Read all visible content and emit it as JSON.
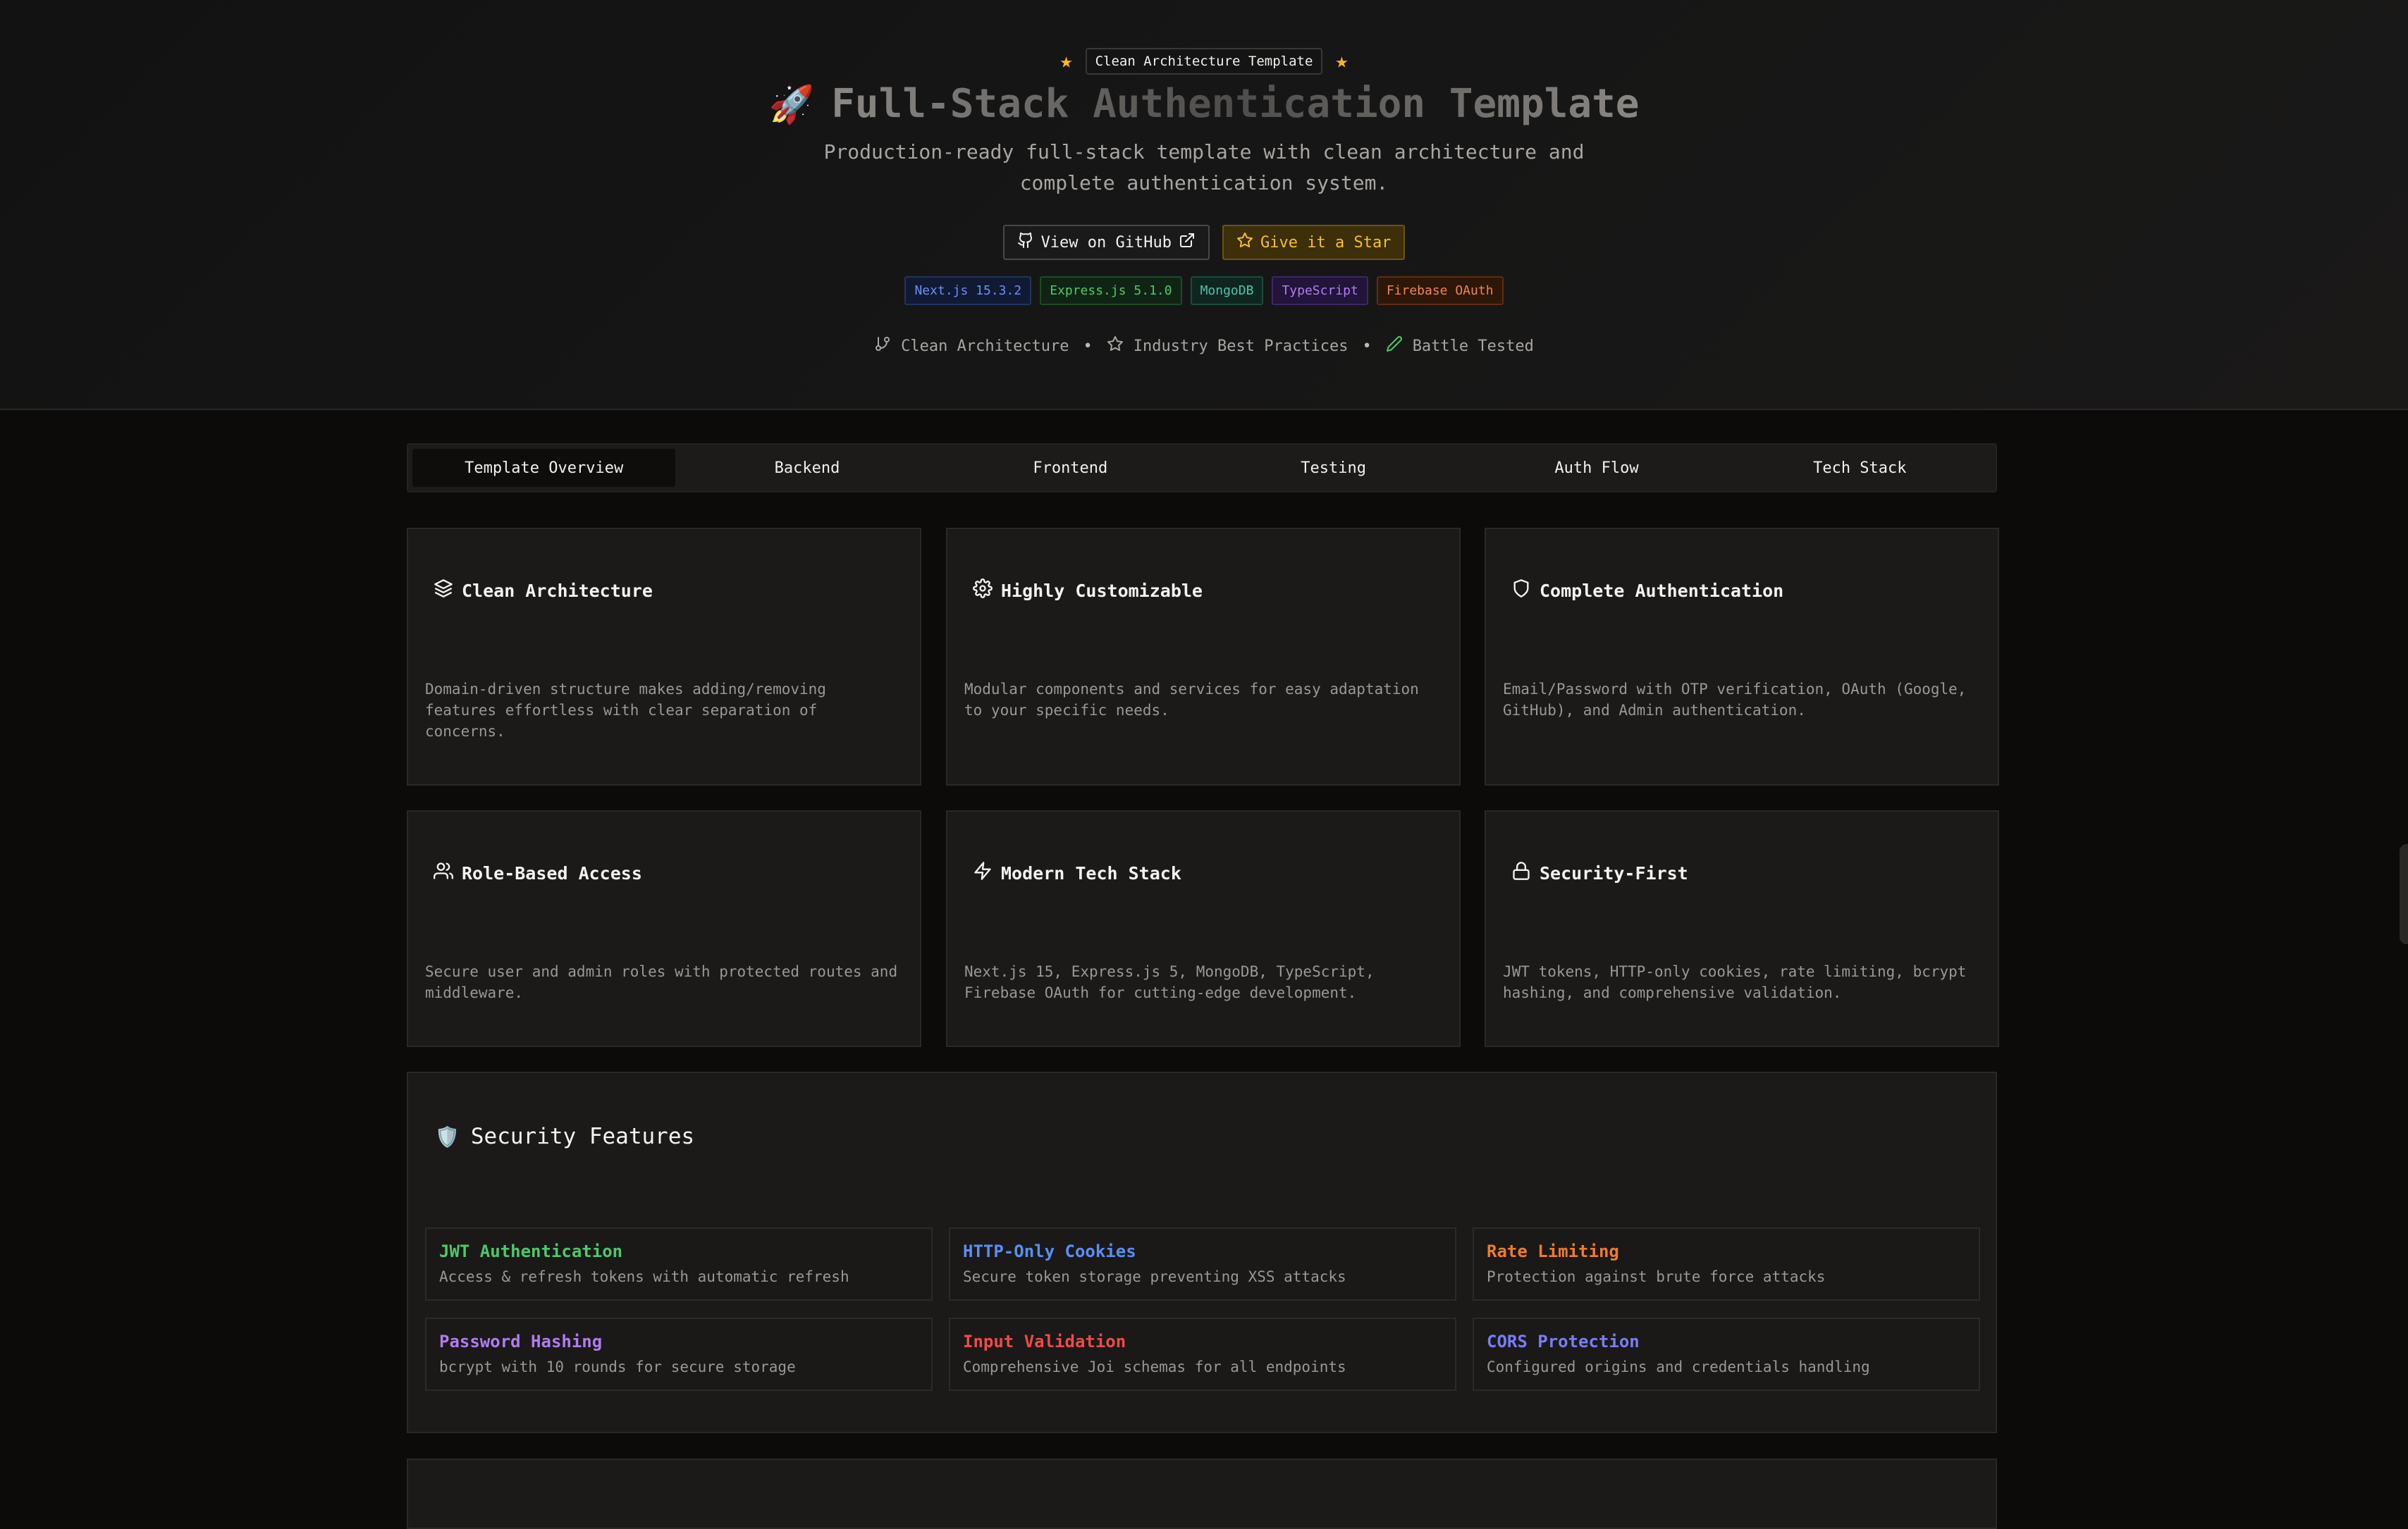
{
  "hero": {
    "badge": "Clean Architecture Template",
    "title_emoji": "🚀",
    "title": "Full-Stack Authentication Template",
    "subtitle": "Production-ready full-stack template with clean architecture and complete authentication system.",
    "buttons": {
      "github": "View on GitHub",
      "star": "Give it a Star"
    },
    "tech": [
      "Next.js 15.3.2",
      "Express.js 5.1.0",
      "MongoDB",
      "TypeScript",
      "Firebase OAuth"
    ],
    "taglines": [
      "Clean Architecture",
      "Industry Best Practices",
      "Battle Tested"
    ]
  },
  "tabs": [
    "Template Overview",
    "Backend",
    "Frontend",
    "Testing",
    "Auth Flow",
    "Tech Stack"
  ],
  "active_tab": "Template Overview",
  "cards": [
    {
      "icon": "layers-icon",
      "title": "Clean Architecture",
      "desc": "Domain-driven structure makes adding/removing features effortless with clear separation of concerns."
    },
    {
      "icon": "gear-icon",
      "title": "Highly Customizable",
      "desc": "Modular components and services for easy adaptation to your specific needs."
    },
    {
      "icon": "shield-icon",
      "title": "Complete Authentication",
      "desc": "Email/Password with OTP verification, OAuth (Google, GitHub), and Admin authentication."
    },
    {
      "icon": "users-icon",
      "title": "Role-Based Access",
      "desc": "Secure user and admin roles with protected routes and middleware."
    },
    {
      "icon": "zap-icon",
      "title": "Modern Tech Stack",
      "desc": "Next.js 15, Express.js 5, MongoDB, TypeScript, Firebase OAuth for cutting-edge development."
    },
    {
      "icon": "lock-icon",
      "title": "Security-First",
      "desc": "JWT tokens, HTTP-only cookies, rate limiting, bcrypt hashing, and comprehensive validation."
    }
  ],
  "security": {
    "emoji": "🛡️",
    "title": "Security Features",
    "features": [
      {
        "title": "JWT Authentication",
        "desc": "Access & refresh tokens with automatic refresh",
        "color": "#4cc96a"
      },
      {
        "title": "HTTP-Only Cookies",
        "desc": "Secure token storage preventing XSS attacks",
        "color": "#5b8ef5"
      },
      {
        "title": "Rate Limiting",
        "desc": "Protection against brute force attacks",
        "color": "#f07a2e"
      },
      {
        "title": "Password Hashing",
        "desc": "bcrypt with 10 rounds for secure storage",
        "color": "#b07cf0"
      },
      {
        "title": "Input Validation",
        "desc": "Comprehensive Joi schemas for all endpoints",
        "color": "#ef4a4a"
      },
      {
        "title": "CORS Protection",
        "desc": "Configured origins and credentials handling",
        "color": "#7b7cf5"
      }
    ]
  }
}
